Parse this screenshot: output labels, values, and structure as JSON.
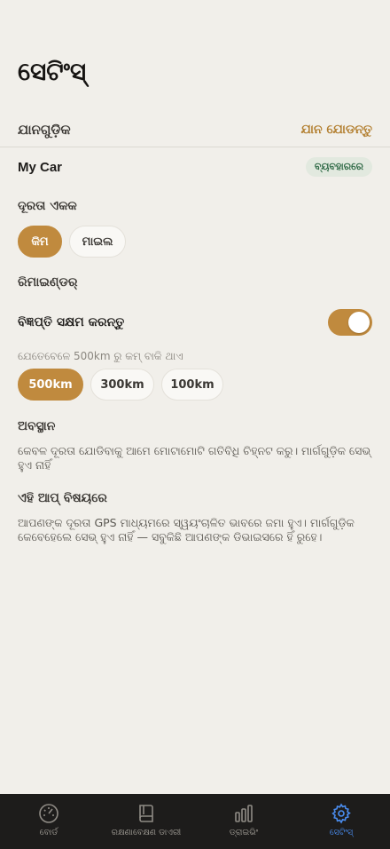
{
  "title": "ସେଟିଂସ୍",
  "vehicles": {
    "section_label": "ଯାନଗୁଡ଼ିକ",
    "add_label": "ଯାନ ଯୋଡନ୍ତୁ",
    "car_name": "My Car",
    "car_status": "ବ୍ୟବହାରରେ"
  },
  "distance_unit": {
    "label": "ଦୂରତା ଏକକ",
    "options": [
      "କିମ",
      "ମାଇଲ"
    ],
    "selected": "କିମ"
  },
  "reminder": {
    "label": "ରିମାଇଣ୍ଡର୍",
    "toggle_label": "ବିଜ୍ଞପ୍ତି ସକ୍ଷମ କରନ୍ତୁ",
    "toggle_on": true,
    "hint": "ଯେତେବେଳେ 500km ରୁ କମ୍ ବାକି ଥାଏ",
    "options": [
      "500km",
      "300km",
      "100km"
    ],
    "selected": "500km"
  },
  "location": {
    "label": "ଅବସ୍ଥାନ",
    "text": "କେବଳ ଦୂରତା ଯୋଡିବାକୁ ଆମେ ମୋଟାମୋଟି ଗତିବିଧି ଚିହ୍ନଟ କରୁ। ମାର୍ଗଗୁଡ଼ିକ ସେଭ୍ ହୁଏ ନାହିଁ"
  },
  "about": {
    "label": "ଏହି ଆପ୍ ବିଷୟରେ",
    "text": "ଆପଣଙ୍କ ଦୂରତା GPS ମାଧ୍ୟମରେ ସ୍ୱୟଂଚାଳିତ ଭାବରେ ଜମା ହୁଏ। ମାର୍ଗଗୁଡ଼ିକ କେବେହେଲେ ସେଭ୍ ହୁଏ ନାହିଁ — ସବୁକିଛି ଆପଣଙ୍କ ଡିଭାଇସରେ ହିଁ ରୁହେ।"
  },
  "tabs": [
    {
      "label": "ବୋର୍ଡ",
      "icon": "speedometer-icon",
      "active": false
    },
    {
      "label": "ରକ୍ଷଣାବେକ୍ଷଣ ଡାଏରୀ",
      "icon": "book-icon",
      "active": false
    },
    {
      "label": "ଡ୍ରାଇଭିଂ",
      "icon": "bar-chart-icon",
      "active": false
    },
    {
      "label": "ସେଟିଂସ୍",
      "icon": "gear-icon",
      "active": true
    }
  ],
  "colors": {
    "accent": "#c08a3e",
    "active_tab": "#4a8df0",
    "background": "#f1efea",
    "tab_bar": "#1d1c1b"
  }
}
